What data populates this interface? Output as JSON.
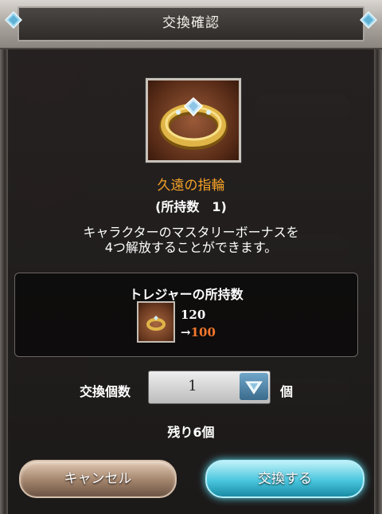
{
  "dialog": {
    "title": "交換確認"
  },
  "item": {
    "name": "久遠の指輪",
    "owned_text": "(所持数　1)",
    "icon": "gold-ring-icon"
  },
  "description": {
    "line1": "キャラクターのマスタリーボーナスを",
    "line2": "4つ解放することができます。"
  },
  "treasure": {
    "title": "トレジャーの所持数",
    "icon": "treasure-ring-icon",
    "current": "120",
    "after_arrow": "→",
    "after_value": "100"
  },
  "exchange": {
    "qty_label": "交換個数",
    "qty_value": "1",
    "qty_unit": "個",
    "remaining": "残り6個"
  },
  "buttons": {
    "cancel": "キャンセル",
    "confirm": "交換する"
  },
  "colors": {
    "item_name": "#f4a127",
    "after_value": "#f4772c",
    "confirm_button": "#49c6de"
  }
}
